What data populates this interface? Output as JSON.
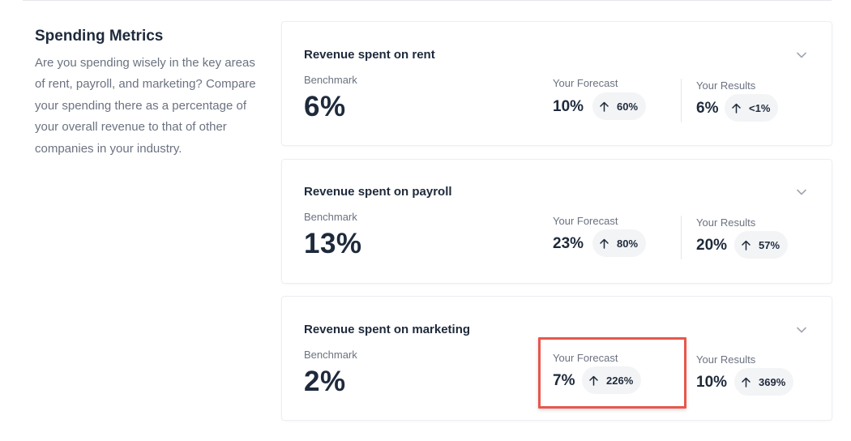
{
  "section": {
    "title": "Spending Metrics",
    "description": "Are you spending wisely in the key areas of rent, payroll, and marketing? Compare your spending there as a percentage of your overall revenue to that of other companies in your industry."
  },
  "labels": {
    "benchmark": "Benchmark",
    "forecast": "Your Forecast",
    "results": "Your Results"
  },
  "cards": [
    {
      "title": "Revenue spent on rent",
      "benchmark": "6%",
      "forecast_value": "10%",
      "forecast_change": "60%",
      "results_value": "6%",
      "results_change": "<1%"
    },
    {
      "title": "Revenue spent on payroll",
      "benchmark": "13%",
      "forecast_value": "23%",
      "forecast_change": "80%",
      "results_value": "20%",
      "results_change": "57%"
    },
    {
      "title": "Revenue spent on marketing",
      "benchmark": "2%",
      "forecast_value": "7%",
      "forecast_change": "226%",
      "results_value": "10%",
      "results_change": "369%"
    }
  ],
  "colors": {
    "highlight_border": "#e8574d",
    "text_primary": "#1e2a3b",
    "text_muted": "#6b7280",
    "pill_bg": "#f3f4f6"
  },
  "icons": {
    "change": "arrow-up-icon",
    "expand": "chevron-down-icon"
  }
}
